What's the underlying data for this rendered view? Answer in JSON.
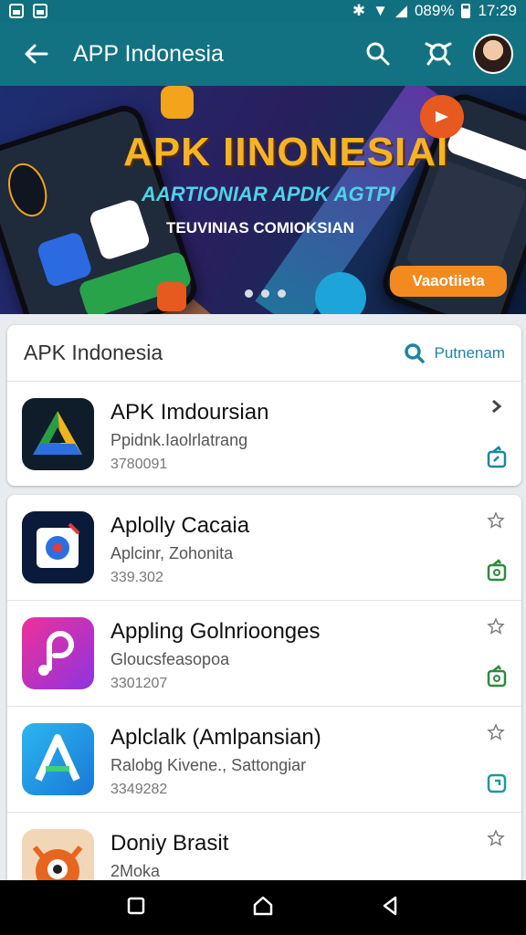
{
  "status_bar": {
    "battery": "089%",
    "time": "17:29"
  },
  "appbar": {
    "title": "APP Indonesia"
  },
  "banner": {
    "headline": "APK IINONESIAI",
    "subtitle": "AARTIONIAR APDK AGTPI",
    "tagline": "TEUVINIAS COMIOKSIAN",
    "cta": "Vaaotiieta"
  },
  "featured": {
    "header": "APK Indonesia",
    "recommend_label": "Putnenam",
    "app": {
      "name": "APK Imdoursian",
      "developer": "Ppidnk.Iaolrlatrang",
      "count": "3780091"
    }
  },
  "apps": [
    {
      "name": "Aplolly Cacaia",
      "developer": "Aplcinr, Zohonita",
      "count": "339.302"
    },
    {
      "name": "Appling Golnrioonges",
      "developer": "Gloucsfeasopoa",
      "count": "3301207"
    },
    {
      "name": "Aplclalk (Amlpansian)",
      "developer": "Ralobg Kivene., Sattongiar",
      "count": "3349282"
    },
    {
      "name": "Doniy Brasit",
      "developer": "2Moka",
      "count": ""
    }
  ],
  "colors": {
    "primary": "#127282",
    "accent": "#f28a1f",
    "link": "#1c86a0",
    "install_green": "#2e8b3b"
  }
}
